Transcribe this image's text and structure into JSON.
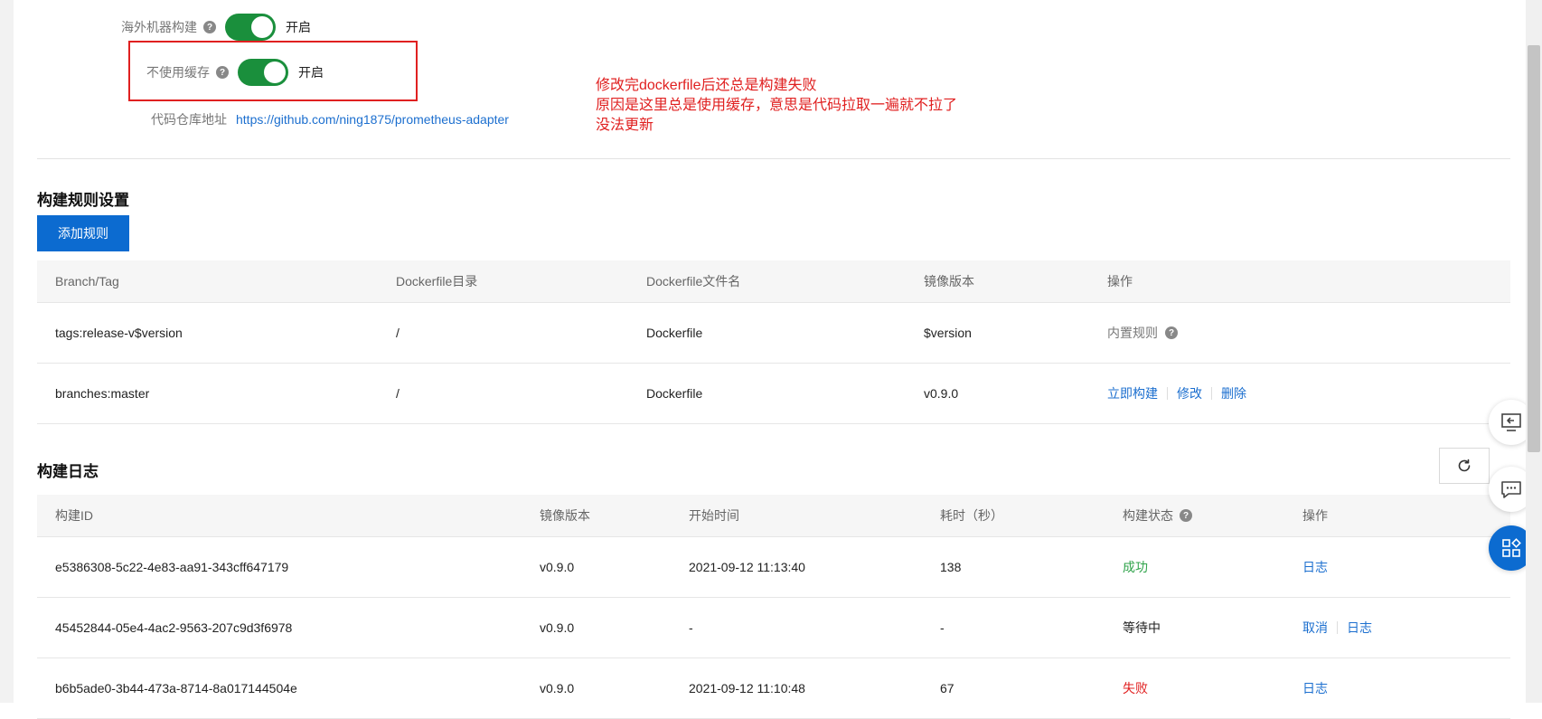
{
  "settings": {
    "overseas_build_label": "海外机器构建",
    "overseas_build_state": "开启",
    "no_cache_label": "不使用缓存",
    "no_cache_state": "开启",
    "repo_label": "代码仓库地址",
    "repo_url": "https://github.com/ning1875/prometheus-adapter"
  },
  "annotation": {
    "line1": "修改完dockerfile后还总是构建失败",
    "line2": "原因是这里总是使用缓存，意思是代码拉取一遍就不拉了",
    "line3": "没法更新",
    "color": "#e02020"
  },
  "build_rules": {
    "title": "构建规则设置",
    "add_button": "添加规则",
    "headers": [
      "Branch/Tag",
      "Dockerfile目录",
      "Dockerfile文件名",
      "镜像版本",
      "操作"
    ],
    "rows": [
      {
        "branch_tag": "tags:release-v$version",
        "dir": "/",
        "filename": "Dockerfile",
        "version": "$version",
        "action": "内置规则"
      },
      {
        "branch_tag": "branches:master",
        "dir": "/",
        "filename": "Dockerfile",
        "version": "v0.9.0",
        "actions": [
          "立即构建",
          "修改",
          "删除"
        ]
      }
    ]
  },
  "build_logs": {
    "title": "构建日志",
    "headers": [
      "构建ID",
      "镜像版本",
      "开始时间",
      "耗时（秒）",
      "构建状态",
      "操作"
    ],
    "rows": [
      {
        "id": "e5386308-5c22-4e83-aa91-343cff647179",
        "version": "v0.9.0",
        "start": "2021-09-12 11:13:40",
        "duration": "138",
        "status": "成功",
        "actions": [
          "日志"
        ]
      },
      {
        "id": "45452844-05e4-4ac2-9563-207c9d3f6978",
        "version": "v0.9.0",
        "start": "-",
        "duration": "-",
        "status": "等待中",
        "actions": [
          "取消",
          "日志"
        ]
      },
      {
        "id": "b6b5ade0-3b44-473a-8714-8a017144504e",
        "version": "v0.9.0",
        "start": "2021-09-12 11:10:48",
        "duration": "67",
        "status": "失败",
        "actions": [
          "日志"
        ]
      }
    ]
  },
  "colors": {
    "accent": "#0c6bd0",
    "toggle_on": "#1a8f3c",
    "success": "#2fa34a",
    "fail": "#e02020",
    "link": "#1c6fcf"
  },
  "icons": {
    "help": "help-icon",
    "refresh": "refresh-icon",
    "float_1": "screen-icon",
    "float_2": "chat-icon",
    "float_3": "apps-icon"
  }
}
